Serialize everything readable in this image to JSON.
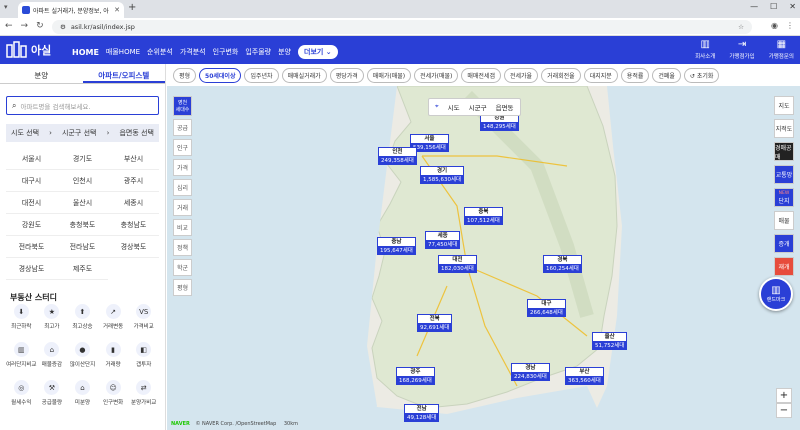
{
  "browser": {
    "tab_title": "아파트 실거래가, 분양정보, 아",
    "url": "asil.kr/asil/index.jsp"
  },
  "header": {
    "logo": "아실",
    "menu": [
      "HOME",
      "매물HOME",
      "순위분석",
      "가격분석",
      "인구변화",
      "입주물량",
      "분양"
    ],
    "more": "더보기",
    "util": [
      "회사소개",
      "가맹점가입",
      "가맹점문의"
    ]
  },
  "sidebar": {
    "tabs": [
      "분양",
      "아파트/오피스텔"
    ],
    "search_placeholder": "아파트명을 검색해보세요.",
    "region": [
      "시도 선택",
      "시군구 선택",
      "읍면동 선택"
    ],
    "cities": [
      "서울시",
      "경기도",
      "부산시",
      "대구시",
      "인천시",
      "광주시",
      "대전시",
      "울산시",
      "세종시",
      "강원도",
      "충청북도",
      "충청남도",
      "전라북도",
      "전라남도",
      "경상북도",
      "경상남도",
      "제주도"
    ],
    "study_title": "부동산 스터디",
    "study": [
      "최근하락",
      "최고가",
      "최고상승",
      "거래변동",
      "가격비교",
      "여러단지비교",
      "매물증감",
      "많이산단지",
      "거래량",
      "갭투자",
      "월세수익",
      "공급물량",
      "미분양",
      "인구변화",
      "분양가비교"
    ]
  },
  "filters": [
    "평형",
    "50세대이상",
    "입주년차",
    "매매실거래가",
    "평당가격",
    "매매가(매물)",
    "전세가(매물)",
    "매매전세갭",
    "전세가율",
    "거래회전율",
    "대지지분",
    "용적률",
    "건폐율",
    "초기화"
  ],
  "left_rail": [
    "공급",
    "인구",
    "가격",
    "심리",
    "거래",
    "비교",
    "정책",
    "학군",
    "평형"
  ],
  "current_loc": [
    "영천",
    "세대수"
  ],
  "maptype": [
    "시도",
    "시군구",
    "읍면동"
  ],
  "right_rail": [
    "지도",
    "지적도",
    "경매공매",
    "교통망",
    "단지",
    "매물",
    "증개",
    "재개"
  ],
  "fab": "랜드마크",
  "new_badge": "NEW",
  "markers": [
    {
      "name": "서울",
      "count": "539,156세대"
    },
    {
      "name": "인천",
      "count": "249,358세대"
    },
    {
      "name": "경기",
      "count": "1,585,630세대"
    },
    {
      "name": "강원",
      "count": "148,295세대"
    },
    {
      "name": "충북",
      "count": "107,512세대"
    },
    {
      "name": "세종",
      "count": "77,450세대"
    },
    {
      "name": "충남",
      "count": "195,647세대"
    },
    {
      "name": "대전",
      "count": "182,030세대"
    },
    {
      "name": "경북",
      "count": "160,254세대"
    },
    {
      "name": "대구",
      "count": "266,648세대"
    },
    {
      "name": "전북",
      "count": "92,691세대"
    },
    {
      "name": "울산",
      "count": "51,752세대"
    },
    {
      "name": "경남",
      "count": "224,830세대"
    },
    {
      "name": "부산",
      "count": "363,560세대"
    },
    {
      "name": "광주",
      "count": "168,269세대"
    },
    {
      "name": "전남",
      "count": "49,128세대"
    }
  ],
  "attribution": {
    "naver": "NAVER",
    "text": "© NAVER Corp. /OpenStreetMap",
    "scale": "30km"
  }
}
